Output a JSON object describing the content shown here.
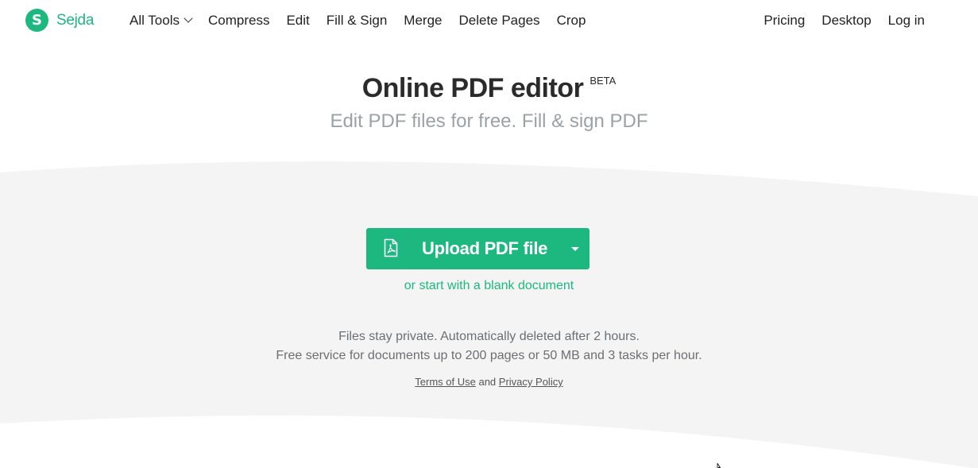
{
  "brand": {
    "logo_letter": "S",
    "name": "Sejda",
    "color": "#1cb87f"
  },
  "nav": {
    "items": [
      {
        "label": "All Tools",
        "has_dropdown": true
      },
      {
        "label": "Compress"
      },
      {
        "label": "Edit"
      },
      {
        "label": "Fill & Sign"
      },
      {
        "label": "Merge"
      },
      {
        "label": "Delete Pages"
      },
      {
        "label": "Crop"
      }
    ],
    "right_items": [
      {
        "label": "Pricing"
      },
      {
        "label": "Desktop"
      },
      {
        "label": "Log in"
      }
    ]
  },
  "hero": {
    "title": "Online PDF editor",
    "badge": "BETA",
    "subtitle": "Edit PDF files for free. Fill & sign PDF"
  },
  "upload": {
    "button_label": "Upload PDF file",
    "icon": "pdf-file-icon",
    "dropdown_icon": "caret-down-icon",
    "blank_link": "or start with a blank document"
  },
  "info": {
    "line1": "Files stay private. Automatically deleted after 2 hours.",
    "line2": "Free service for documents up to 200 pages or 50 MB and 3 tasks per hour."
  },
  "legal": {
    "terms": "Terms of Use",
    "and": "and",
    "privacy": "Privacy Policy"
  },
  "colors": {
    "accent": "#1cb87f",
    "band": "#f4f4f4",
    "subtitle": "#9aa2a8"
  }
}
